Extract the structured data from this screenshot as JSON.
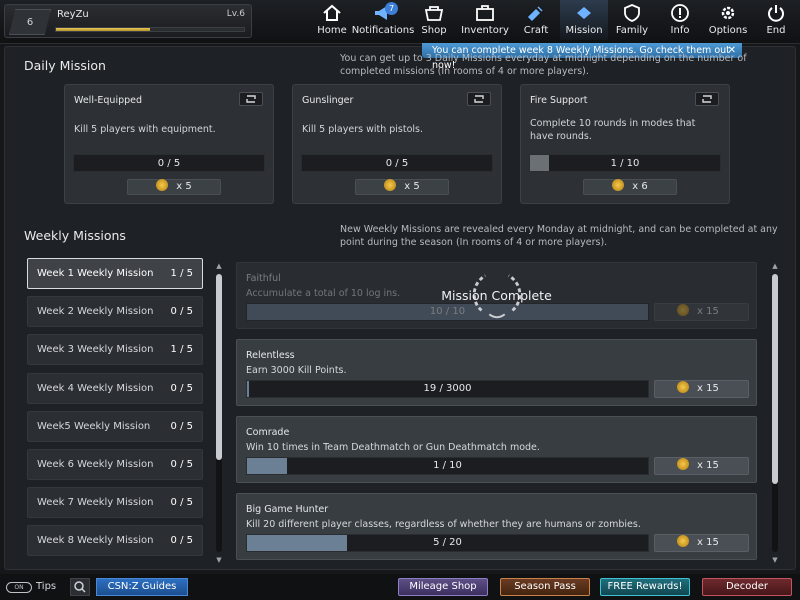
{
  "profile": {
    "rank": "6",
    "name": "ReyZu",
    "level": "Lv.6",
    "xp_fraction": 0.5
  },
  "nav": {
    "home": "Home",
    "notifications": "Notifications",
    "notifications_badge": "7",
    "shop": "Shop",
    "inventory": "Inventory",
    "craft": "Craft",
    "mission": "Mission",
    "family": "Family",
    "info": "Info",
    "options": "Options",
    "end": "End"
  },
  "notice": {
    "text": "You can complete week 8 Weekly Missions. Go check them out now!",
    "close": "✕"
  },
  "daily": {
    "title": "Daily Mission",
    "desc": "You can get up to 3 Daily Missions everyday at midnight depending on the number of completed missions (In rooms of 4 or more players).",
    "cards": [
      {
        "title": "Well-Equipped",
        "desc": "Kill 5 players with equipment.",
        "progress": "0 / 5",
        "fraction": 0,
        "reward": "x 5"
      },
      {
        "title": "Gunslinger",
        "desc": "Kill 5 players with pistols.",
        "progress": "0 / 5",
        "fraction": 0,
        "reward": "x 5"
      },
      {
        "title": "Fire Support",
        "desc": "Complete 10 rounds in modes that have rounds.",
        "progress": "1 / 10",
        "fraction": 0.1,
        "reward": "x 6"
      }
    ]
  },
  "weekly": {
    "title": "Weekly Missions",
    "desc": "New Weekly Missions are revealed every Monday at midnight, and can be completed at any point during the season (In rooms of 4 or more players).",
    "weeks": [
      {
        "label": "Week 1 Weekly Mission",
        "count": "1 / 5"
      },
      {
        "label": "Week 2 Weekly Mission",
        "count": "0 / 5"
      },
      {
        "label": "Week 3 Weekly Mission",
        "count": "1 / 5"
      },
      {
        "label": "Week 4 Weekly Mission",
        "count": "0 / 5"
      },
      {
        "label": "Week5 Weekly Mission",
        "count": "0 / 5"
      },
      {
        "label": "Week 6 Weekly Mission",
        "count": "0 / 5"
      },
      {
        "label": "Week 7 Weekly Mission",
        "count": "0 / 5"
      },
      {
        "label": "Week 8 Weekly Mission",
        "count": "0 / 5"
      }
    ],
    "missions": [
      {
        "title": "Faithful",
        "desc": "Accumulate a total of 10 log ins.",
        "progress": "10 / 10",
        "fraction": 1,
        "reward": "x 15",
        "status": "Mission Complete"
      },
      {
        "title": "Relentless",
        "desc": "Earn 3000 Kill Points.",
        "progress": "19 / 3000",
        "fraction": 0.006,
        "reward": "x 15"
      },
      {
        "title": "Comrade",
        "desc": "Win 10 times in Team Deathmatch or Gun Deathmatch mode.",
        "progress": "1 / 10",
        "fraction": 0.1,
        "reward": "x 15"
      },
      {
        "title": "Big Game Hunter",
        "desc": "Kill 20 different player classes, regardless of whether they are humans or zombies.",
        "progress": "5 / 20",
        "fraction": 0.25,
        "reward": "x 15"
      }
    ]
  },
  "bottom": {
    "tips_toggle": "ON",
    "tips": "Tips",
    "guides": "CSN:Z Guides",
    "mileage": "Mileage Shop",
    "season": "Season Pass",
    "free": "FREE Rewards!",
    "decoder": "Decoder"
  }
}
